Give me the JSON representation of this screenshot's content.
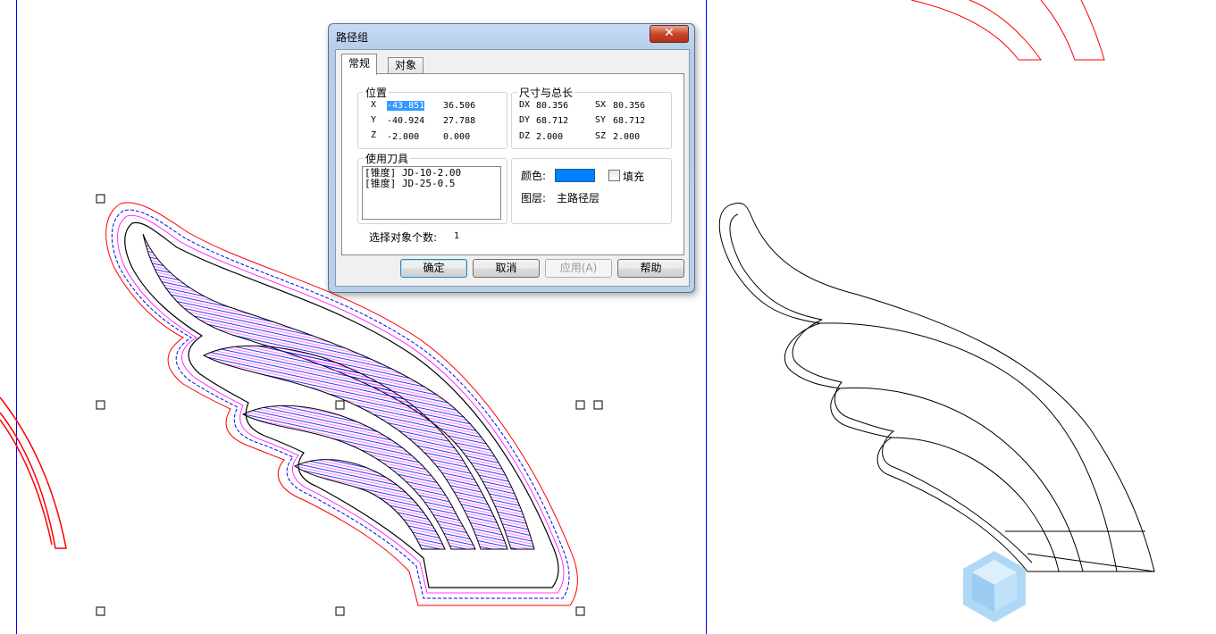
{
  "dialog": {
    "title": "路径组",
    "close_label": "✕",
    "tabs": [
      {
        "label": "常规",
        "active": true
      },
      {
        "label": "对象",
        "active": false
      }
    ],
    "position": {
      "label": "位置",
      "rows": [
        {
          "axis": "X",
          "value1": "-43.851",
          "value2": "36.506"
        },
        {
          "axis": "Y",
          "value1": "-40.924",
          "value2": "27.788"
        },
        {
          "axis": "Z",
          "value1": "-2.000",
          "value2": "0.000"
        }
      ]
    },
    "size": {
      "label": "尺寸与总长",
      "rows": [
        {
          "d_label": "DX",
          "d_value": "80.356",
          "s_label": "SX",
          "s_value": "80.356"
        },
        {
          "d_label": "DY",
          "d_value": "68.712",
          "s_label": "SY",
          "s_value": "68.712"
        },
        {
          "d_label": "DZ",
          "d_value": "2.000",
          "s_label": "SZ",
          "s_value": "2.000"
        }
      ]
    },
    "tools": {
      "label": "使用刀具",
      "items": [
        "[锥度] JD-10-2.00",
        "[锥度] JD-25-0.5"
      ]
    },
    "appearance": {
      "color_label": "颜色:",
      "color_value": "#0080ff",
      "fill_label": "填充",
      "fill_checked": false,
      "layer_label": "图层:",
      "layer_value": "主路径层"
    },
    "selection_count_label": "选择对象个数:",
    "selection_count_value": "1",
    "buttons": {
      "ok": "确定",
      "cancel": "取消",
      "apply": "应用(A)",
      "help": "帮助"
    }
  },
  "colors": {
    "toolpath_blue": "#0000ff",
    "toolpath_magenta": "#ff00ff",
    "boundary_red": "#ff0000",
    "page_border": "#0000ff",
    "outline": "#000000"
  },
  "icons": [
    "close-icon",
    "app-cube-icon"
  ]
}
